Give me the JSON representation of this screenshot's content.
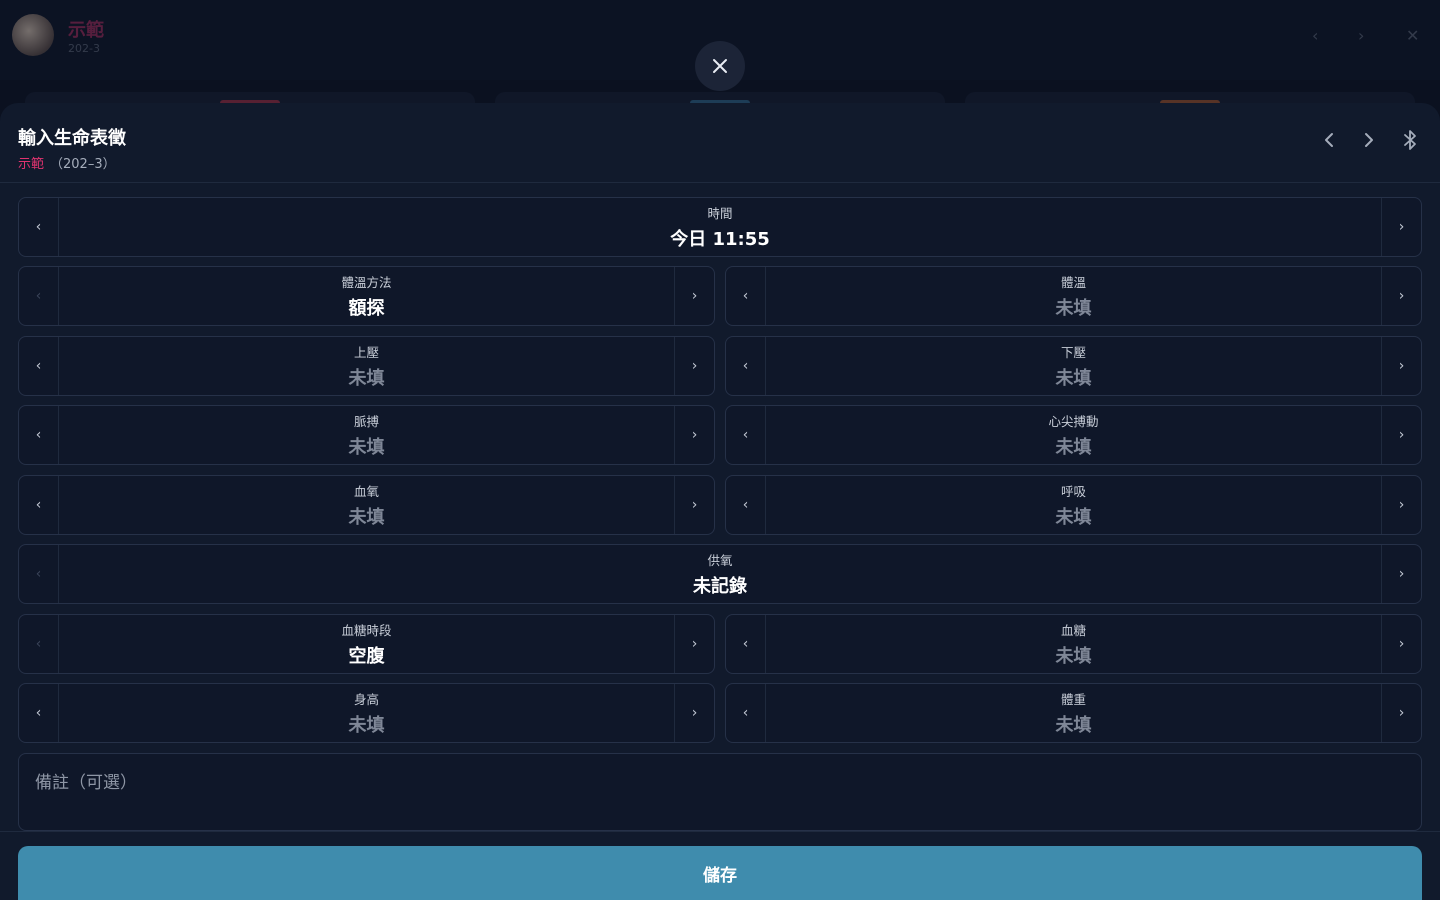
{
  "background": {
    "patient_name": "示範",
    "patient_sub": "202-3"
  },
  "header": {
    "title": "輸入生命表徵",
    "patient_name": "示範",
    "room": "（202–3）"
  },
  "fields": {
    "time": {
      "label": "時間",
      "value": "今日 11:55"
    },
    "temp_method": {
      "label": "體溫方法",
      "value": "額探"
    },
    "temperature": {
      "label": "體溫",
      "value": "未填"
    },
    "systolic": {
      "label": "上壓",
      "value": "未填"
    },
    "diastolic": {
      "label": "下壓",
      "value": "未填"
    },
    "pulse": {
      "label": "脈搏",
      "value": "未填"
    },
    "apical_pulse": {
      "label": "心尖搏動",
      "value": "未填"
    },
    "spo2": {
      "label": "血氧",
      "value": "未填"
    },
    "respiration": {
      "label": "呼吸",
      "value": "未填"
    },
    "oxygen": {
      "label": "供氧",
      "value": "未記錄"
    },
    "glucose_period": {
      "label": "血糖時段",
      "value": "空腹"
    },
    "glucose": {
      "label": "血糖",
      "value": "未填"
    },
    "height": {
      "label": "身高",
      "value": "未填"
    },
    "weight": {
      "label": "體重",
      "value": "未填"
    }
  },
  "note": {
    "placeholder": "備註（可選）"
  },
  "save_label": "儲存",
  "icons": {
    "close": "close-icon",
    "prev": "chevron-left-icon",
    "next": "chevron-right-icon",
    "bluetooth": "bluetooth-icon"
  },
  "colors": {
    "accent_pink": "#e0336f",
    "save_button": "#3f8cad",
    "sheet_bg": "#111a2c"
  }
}
